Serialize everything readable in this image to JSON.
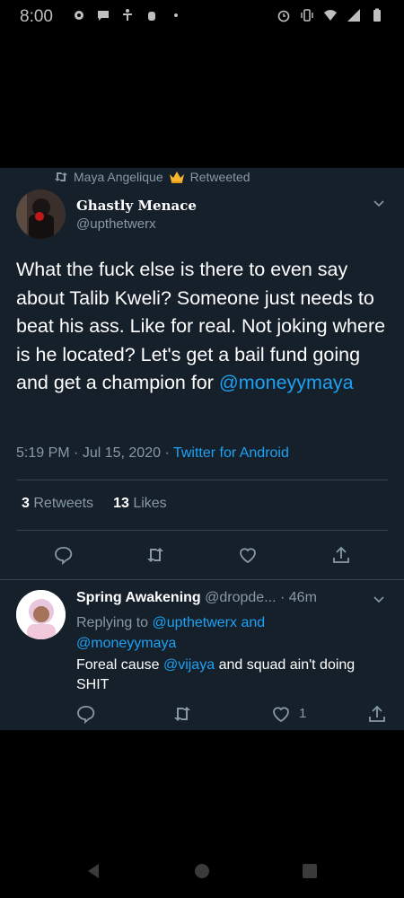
{
  "status_bar": {
    "time": "8:00"
  },
  "retweet_banner": {
    "label": "Maya Angelique",
    "suffix": "Retweeted"
  },
  "tweet": {
    "display_name": "Ghastly Menace",
    "handle": "@upthetwerx",
    "text_main": "What the fuck else is there to even say about Talib Kweli? Someone just needs to beat his ass. Like for real. Not joking where is he located? Let's get a bail fund going and get a champion for",
    "mention": "@moneyymaya",
    "time": "5:19 PM",
    "date": "Jul 15, 2020",
    "source": "Twitter for Android",
    "retweets_count": "3",
    "retweets_label": "Retweets",
    "likes_count": "13",
    "likes_label": "Likes"
  },
  "reply": {
    "display_name": "Spring Awakening",
    "handle": "@dropde...",
    "time": "46m",
    "replying_prefix": "Replying to",
    "replying_to_1": "@upthetwerx",
    "replying_and": "and",
    "replying_to_2": "@moneyymaya",
    "text_before": "Foreal cause",
    "text_mention": "@vijaya",
    "text_after": "and squad ain't doing SHIT",
    "likes": "1"
  },
  "icons": {
    "retweet": "retweet-icon",
    "reply": "reply-icon",
    "like": "heart-icon",
    "share": "share-icon",
    "more": "chevron-down-icon",
    "verified_emoji": "crown-icon"
  },
  "colors": {
    "background": "#15202b",
    "accent": "#1da1f2",
    "muted": "#8899a6",
    "divider": "#38444d"
  }
}
